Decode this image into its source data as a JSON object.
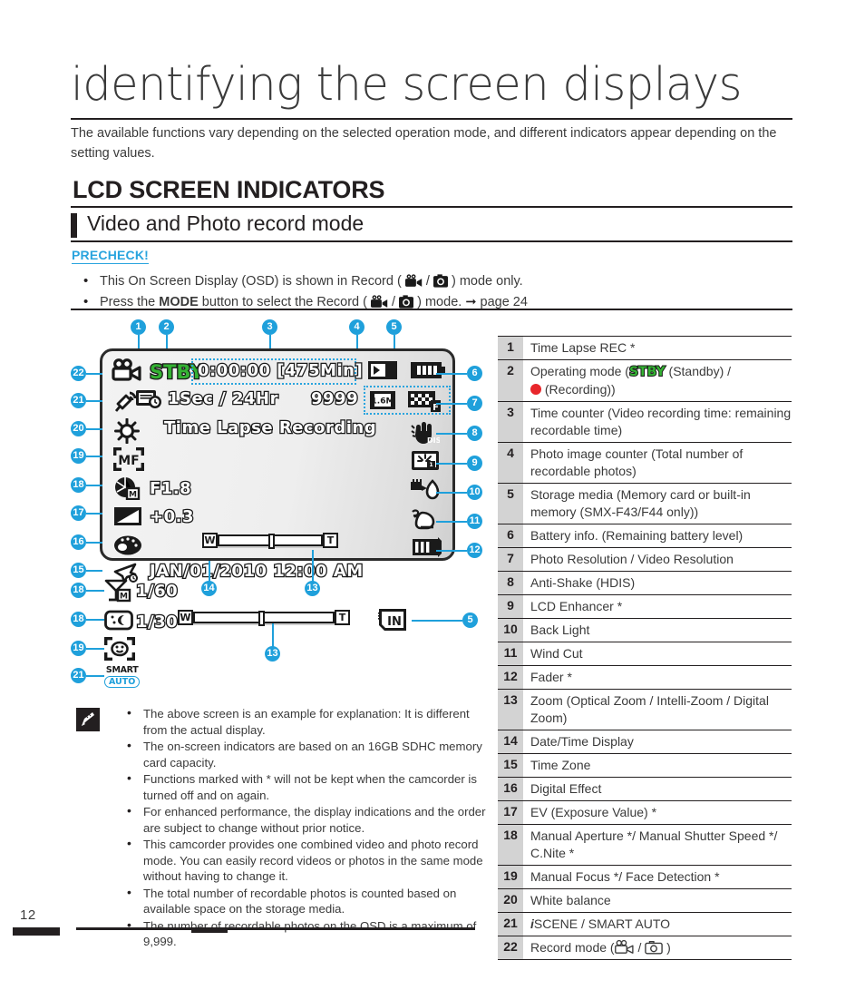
{
  "page": {
    "number": "12"
  },
  "header": {
    "chapter_title": "identifying the screen displays",
    "intro": "The available functions vary depending on the selected operation mode, and different indicators appear depending on the setting values.",
    "section_title": "LCD SCREEN INDICATORS",
    "subsection_title": "Video and Photo record mode",
    "precheck_label": "PRECHECK!",
    "precheck_items": [
      "This On Screen Display (OSD) is shown in Record (  /  ) mode only.",
      "Press the MODE button to select the Record (  /  ) mode.  page 24"
    ],
    "precheck_item1_parts": {
      "a": "This On Screen Display (OSD) is shown in Record (",
      "b": " / ",
      "c": ") mode only."
    },
    "precheck_item2_parts": {
      "a": "Press the ",
      "bold": "MODE",
      "b": " button to select the Record (",
      "c": " / ",
      "d": " ) mode. ",
      "e": " page 24"
    }
  },
  "lcd": {
    "status": "STBY",
    "time_counter": "0:00:00 [475Min]",
    "timelapse_interval": "1Sec / 24Hr",
    "timelapse_label": "Time Lapse Recording",
    "photo_counter": "9999",
    "photo_resolution": "1.6M",
    "aperture": "F1.8",
    "ev": "+0.3",
    "datetime": "JAN/01/2010 12:00 AM",
    "shutter_speed": "1/60",
    "cnite": "1/30",
    "zoom_w": "W",
    "zoom_t": "T",
    "storage_in": "IN",
    "smart_label": "SMART",
    "auto_label": "AUTO",
    "icons": {
      "record_mode": "camcorder-icon",
      "timelapse": "timelapse-rec-icon",
      "white_balance": "white-balance-sun-icon",
      "iscene": "iscene-icon",
      "manual_focus": "manual-focus-icon",
      "manual_aperture": "manual-aperture-icon",
      "ev": "ev-icon",
      "digital_effect": "digital-effect-palette-icon",
      "time_zone": "time-zone-airplane-icon",
      "storage_media": "memory-card-icon",
      "battery": "battery-icon",
      "video_resolution": "video-resolution-icon",
      "anti_shake": "anti-shake-hdis-icon",
      "lcd_enhancer": "lcd-enhancer-icon",
      "back_light": "back-light-icon",
      "wind_cut": "wind-cut-icon",
      "fader": "fader-icon",
      "manual_shutter": "manual-shutter-icon",
      "face_detection": "face-detection-icon"
    },
    "callouts_top": [
      "1",
      "2",
      "3",
      "4",
      "5"
    ],
    "callouts_right": [
      "6",
      "7",
      "8",
      "9",
      "10",
      "11",
      "12"
    ],
    "callouts_left": [
      "22",
      "21",
      "20",
      "19",
      "18",
      "17",
      "16",
      "15"
    ],
    "callouts_below_left": [
      "18",
      "18",
      "19",
      "21"
    ],
    "callouts_bottom": [
      "14",
      "13"
    ],
    "callout_zoom2": "13",
    "callout_in": "5"
  },
  "colors": {
    "accent_blue": "#1fa0db",
    "precheck_blue": "#29a4de",
    "stby_green": "#34b233",
    "rec_red": "#e8262b",
    "table_num_bg": "#d3d3d3",
    "ink": "#231f20"
  },
  "table": {
    "rows": [
      {
        "num": "1",
        "text": "Time Lapse REC *"
      },
      {
        "num": "2",
        "text": "Operating mode (STBY (Standby) / (Recording))",
        "html": "special_stby"
      },
      {
        "num": "3",
        "text": "Time counter (Video recording time: remaining recordable time)"
      },
      {
        "num": "4",
        "text": "Photo image counter (Total number of recordable photos)"
      },
      {
        "num": "5",
        "text": "Storage media (Memory card or built-in memory (SMX-F43/F44 only))"
      },
      {
        "num": "6",
        "text": "Battery info. (Remaining battery level)"
      },
      {
        "num": "7",
        "text": "Photo Resolution / Video Resolution"
      },
      {
        "num": "8",
        "text": "Anti-Shake (HDIS)"
      },
      {
        "num": "9",
        "text": "LCD Enhancer *"
      },
      {
        "num": "10",
        "text": "Back Light"
      },
      {
        "num": "11",
        "text": "Wind Cut"
      },
      {
        "num": "12",
        "text": "Fader *"
      },
      {
        "num": "13",
        "text": "Zoom (Optical Zoom / Intelli-Zoom / Digital Zoom)"
      },
      {
        "num": "14",
        "text": "Date/Time Display"
      },
      {
        "num": "15",
        "text": "Time Zone"
      },
      {
        "num": "16",
        "text": "Digital Effect"
      },
      {
        "num": "17",
        "text": "EV (Exposure Value) *"
      },
      {
        "num": "18",
        "text": "Manual Aperture */ Manual Shutter Speed */ C.Nite *"
      },
      {
        "num": "19",
        "text": "Manual Focus */ Face Detection *"
      },
      {
        "num": "20",
        "text": "White balance"
      },
      {
        "num": "21",
        "text": "iSCENE / SMART AUTO"
      },
      {
        "num": "22",
        "text": "Record mode (  /  )"
      }
    ],
    "row2_prefix": "Operating mode (",
    "row2_mid": " (Standby) /",
    "row2_suffix": " (Recording))",
    "row21_i": "i",
    "row21_rest": "SCENE / SMART AUTO",
    "row22_prefix": "Record mode (",
    "row22_sep": " / ",
    "row22_suffix": " )"
  },
  "notes": {
    "icon": "note-pen-icon",
    "items": [
      "The above screen is an example for explanation: It is different from the actual display.",
      "The on-screen indicators are based on an 16GB SDHC memory card capacity.",
      "Functions marked with * will not be kept when the camcorder is turned off and on again.",
      "For enhanced performance, the display indications and the order are subject to change without prior notice.",
      "This camcorder provides one combined video and photo record mode. You can easily record videos or photos in the same mode without having to change it.",
      "The total number of recordable photos is counted based on available space on the storage media.",
      "The number of recordable photos on the OSD is a maximum of 9,999."
    ]
  }
}
